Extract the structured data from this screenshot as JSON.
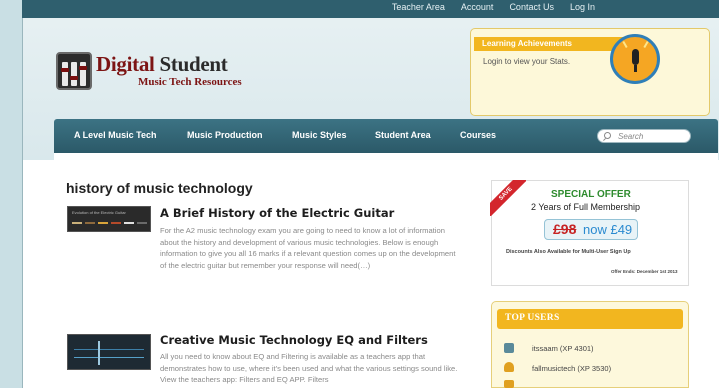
{
  "top_nav": [
    "Teacher Area",
    "Account",
    "Contact Us",
    "Log In"
  ],
  "logo": {
    "title_prefix": "Digital",
    "title_suffix": " Student",
    "subtitle": "Music Tech Resources"
  },
  "achievements": {
    "title": "Learning Achievements",
    "message": "Login to view your Stats."
  },
  "main_nav": [
    "A Level Music Tech",
    "Music Production",
    "Music Styles",
    "Student Area",
    "Courses"
  ],
  "search": {
    "placeholder": "Search"
  },
  "page_heading": "history of music technology",
  "posts": [
    {
      "thumb_caption": "Evolution of the Electric Guitar",
      "title": "A Brief History of the Electric Guitar",
      "body": "For the A2 music technology exam you are going to need to know a lot of information about the history and development of various music technologies. Below is enough information to give you all 16 marks if a relevant question comes up on the development of the electric guitar but remember your response will need(…)"
    },
    {
      "title": "Creative Music Technology EQ and Filters",
      "body": "All you need to know about EQ and Filtering is available as a teachers app that demonstrates how to use, where it's been used and what the various settings sound like. View the teachers app: Filters and EQ APP. Filters"
    }
  ],
  "offer": {
    "ribbon": "SAVE",
    "title": "SPECIAL OFFER",
    "subtitle": "2 Years of Full Membership",
    "old_price": "£98",
    "new_price": "now £49",
    "note": "Discounts Also Available for Multi-User Sign Up",
    "ends": "Offer Ends: December 1st 2013"
  },
  "top_users": {
    "title": "TOP USERS",
    "users": [
      {
        "name": "itssaam (XP 4301)",
        "icon_color": "#5a8a9a"
      },
      {
        "name": "fallmusictech (XP 3530)",
        "icon_color": "#e0a020"
      }
    ]
  }
}
